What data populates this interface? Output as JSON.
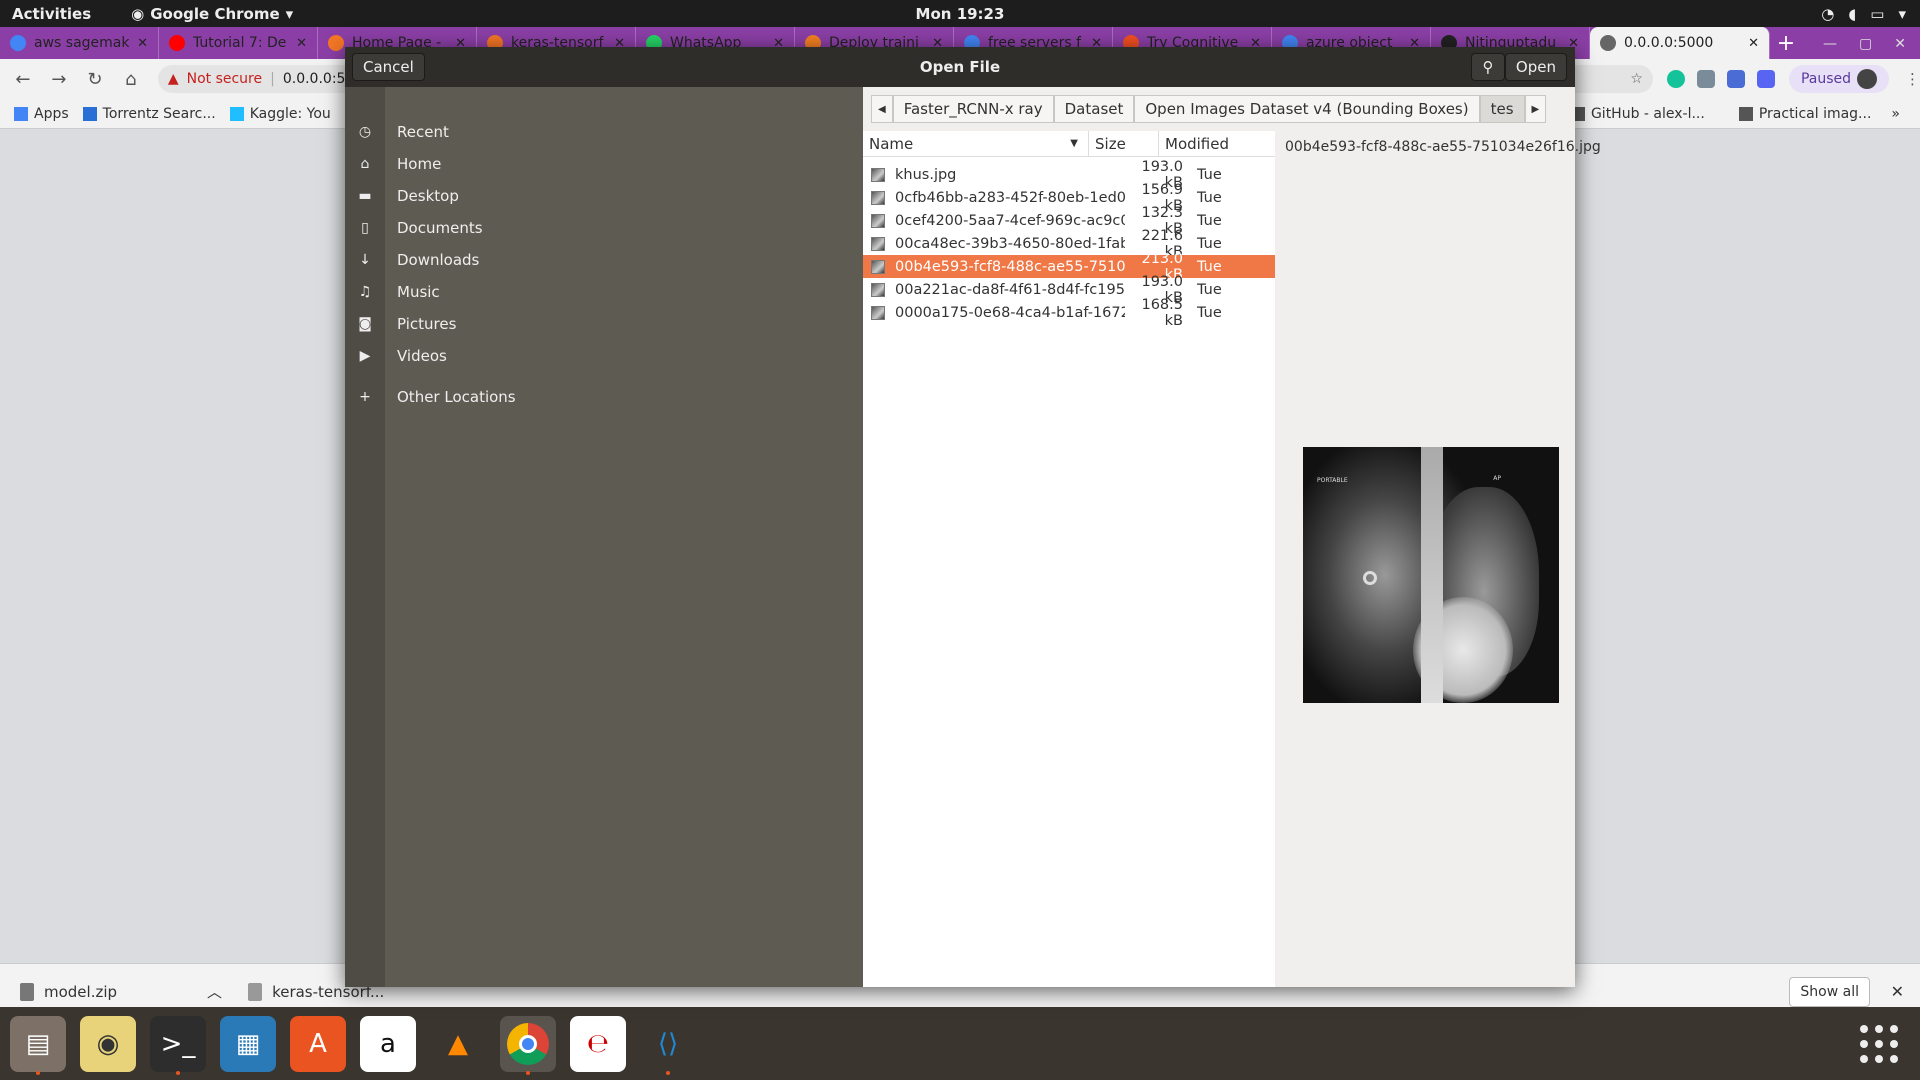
{
  "topbar": {
    "activities": "Activities",
    "app_name": "Google Chrome",
    "clock": "Mon 19:23"
  },
  "tabs": [
    {
      "title": "aws sagemak",
      "icon": "google-icon",
      "color": "#4285f4"
    },
    {
      "title": "Tutorial 7: De",
      "icon": "youtube-icon",
      "color": "#ff0000"
    },
    {
      "title": "Home Page -",
      "icon": "jupyter-icon",
      "color": "#f37626"
    },
    {
      "title": "keras-tensorf",
      "icon": "jupyter-icon",
      "color": "#f37626"
    },
    {
      "title": "WhatsApp",
      "icon": "whatsapp-icon",
      "color": "#25d366"
    },
    {
      "title": "Deploy traini",
      "icon": "stackoverflow-icon",
      "color": "#f48024"
    },
    {
      "title": "free servers f",
      "icon": "google-icon",
      "color": "#4285f4"
    },
    {
      "title": "Try Cognitive",
      "icon": "microsoft-icon",
      "color": "#f25022"
    },
    {
      "title": "azure object",
      "icon": "google-icon",
      "color": "#4285f4"
    },
    {
      "title": "Nitinguptadu",
      "icon": "github-icon",
      "color": "#222222"
    },
    {
      "title": "0.0.0.0:5000",
      "icon": "globe-icon",
      "color": "#666666",
      "active": true
    }
  ],
  "omnibox": {
    "security": "Not secure",
    "url": "0.0.0.0:5000"
  },
  "profile": {
    "status": "Paused"
  },
  "bookmarks": [
    {
      "label": "Apps"
    },
    {
      "label": "Torrentz Searc..."
    },
    {
      "label": "Kaggle: You"
    }
  ],
  "bookmarks_right": [
    {
      "label": "GitHub - alex-l..."
    },
    {
      "label": "Practical imag..."
    }
  ],
  "dialog": {
    "title": "Open File",
    "cancel": "Cancel",
    "open": "Open",
    "sidebar": [
      {
        "label": "Recent",
        "icon": "clock-icon"
      },
      {
        "label": "Home",
        "icon": "home-icon"
      },
      {
        "label": "Desktop",
        "icon": "folder-icon"
      },
      {
        "label": "Documents",
        "icon": "document-icon"
      },
      {
        "label": "Downloads",
        "icon": "download-icon"
      },
      {
        "label": "Music",
        "icon": "music-icon"
      },
      {
        "label": "Pictures",
        "icon": "camera-icon"
      },
      {
        "label": "Videos",
        "icon": "video-icon"
      },
      {
        "label": "Other Locations",
        "icon": "plus-icon"
      }
    ],
    "path": [
      "Faster_RCNN-x ray",
      "Dataset",
      "Open Images Dataset v4 (Bounding Boxes)",
      "tes"
    ],
    "columns": {
      "name": "Name",
      "size": "Size",
      "modified": "Modified"
    },
    "files": [
      {
        "name": "khus.jpg",
        "size": "193.0 kB",
        "modified": "Tue"
      },
      {
        "name": "0cfb46bb-a283-452f-80eb-1ed04...",
        "size": "156.9 kB",
        "modified": "Tue"
      },
      {
        "name": "0cef4200-5aa7-4cef-969c-ac9c0d...",
        "size": "132.3 kB",
        "modified": "Tue"
      },
      {
        "name": "00ca48ec-39b3-4650-80ed-1fab3...",
        "size": "221.6 kB",
        "modified": "Tue"
      },
      {
        "name": "00b4e593-fcf8-488c-ae55-75103...",
        "size": "213.0 kB",
        "modified": "Tue",
        "selected": true
      },
      {
        "name": "00a221ac-da8f-4f61-8d4f-fc1951...",
        "size": "193.0 kB",
        "modified": "Tue"
      },
      {
        "name": "0000a175-0e68-4ca4-b1af-16720...",
        "size": "168.5 kB",
        "modified": "Tue"
      }
    ],
    "preview": {
      "filename": "00b4e593-fcf8-488c-ae55-751034e26f16.jpg",
      "label_left": "PORTABLE",
      "label_right": "AP"
    }
  },
  "downloads": {
    "item1": "model.zip",
    "item2": "keras-tensorf...",
    "show_all": "Show all"
  },
  "colors": {
    "accent": "#f07746",
    "tabstrip": "#8b3fa6"
  }
}
